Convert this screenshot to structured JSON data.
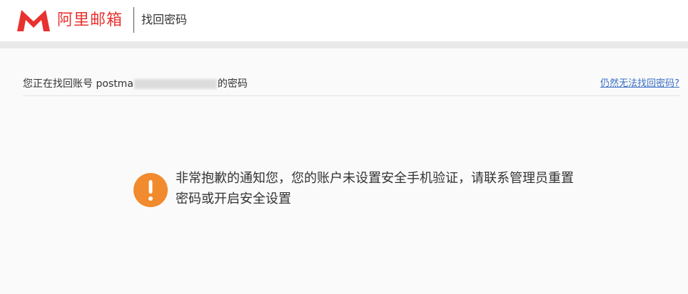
{
  "header": {
    "brand_name": "阿里邮箱",
    "page_title": "找回密码",
    "brand_color": "#e8322f"
  },
  "account": {
    "prefix": "您正在找回账号 postma",
    "suffix": "的密码",
    "help_link": "仍然无法找回密码?"
  },
  "notice": {
    "icon": "exclamation-icon",
    "icon_color": "#f28a2e",
    "message": "非常抱歉的通知您，您的账户未设置安全手机验证，请联系管理员重置密码或开启安全设置"
  }
}
